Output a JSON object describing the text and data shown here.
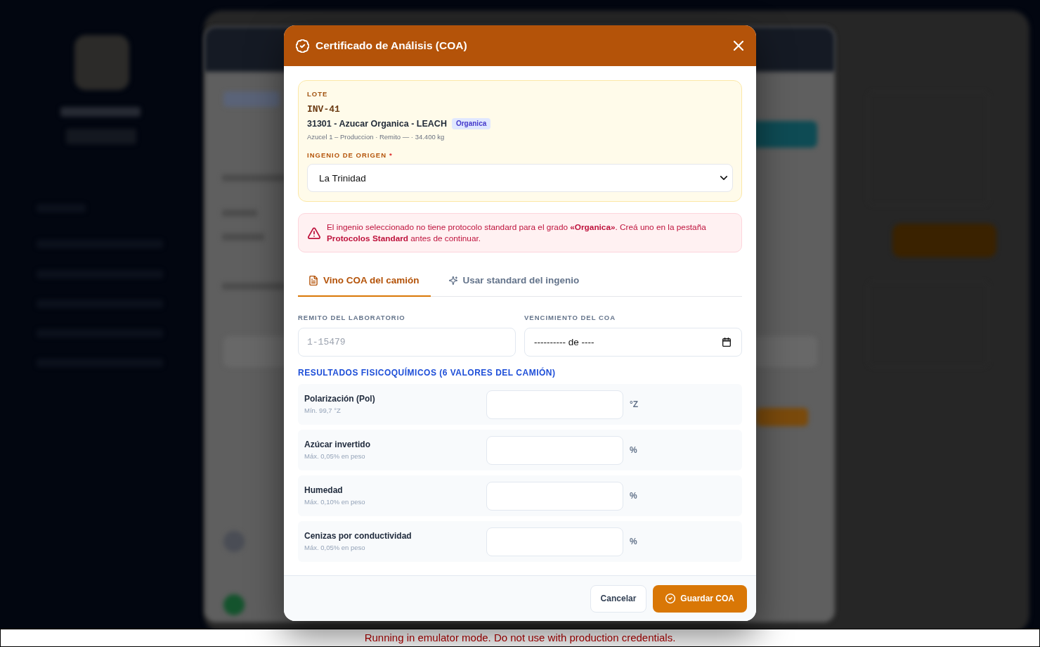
{
  "dialog": {
    "title": "Certificado de Análisis (COA)",
    "lot": {
      "label": "LOTE",
      "code": "INV-41",
      "product": "31301 - Azucar Organica - LEACH",
      "grade_badge": "Organica",
      "details": "Azucel 1 – Produccion · Remito — · 34.400 kg",
      "origin_field": {
        "label": "INGENIO DE ORIGEN",
        "required_mark": "*",
        "value": "La Trinidad"
      }
    },
    "alert": {
      "kind": "error",
      "text": "El ingenio seleccionado no tiene protocolo standard para el grado **«Organica»**. Creá uno en la pestaña **Protocolos Standard** antes de continuar."
    },
    "tabs": [
      {
        "label": "Vino COA del camión",
        "selected": true
      },
      {
        "label": "Usar standard del ingenio",
        "selected": false
      }
    ],
    "fields": [
      {
        "kind": "text",
        "label": "REMITO DEL LABORATORIO",
        "placeholder": "1-15479"
      },
      {
        "kind": "date",
        "label": "VENCIMIENTO DEL COA",
        "placeholder": "---------- de ----"
      }
    ],
    "results": {
      "heading": "RESULTADOS FISICOQUÍMICOS (6 VALORES DEL CAMIÓN)",
      "rows": [
        {
          "name": "Polarización (Pol)",
          "limit": "Mín. 99,7 °Z",
          "unit": "°Z"
        },
        {
          "name": "Azúcar invertido",
          "limit": "Máx. 0,05% en peso",
          "unit": "%"
        },
        {
          "name": "Humedad",
          "limit": "Máx. 0,10% en peso",
          "unit": "%"
        },
        {
          "name": "Cenizas por conductividad",
          "limit": "Máx. 0,05% en peso",
          "unit": "%"
        }
      ]
    },
    "buttons": [
      {
        "kind": "secondary",
        "label": "Cancelar"
      },
      {
        "kind": "primary",
        "label": "Guardar COA"
      }
    ]
  },
  "banner": {
    "text": "Running in emulator mode. Do not use with production credentials."
  }
}
